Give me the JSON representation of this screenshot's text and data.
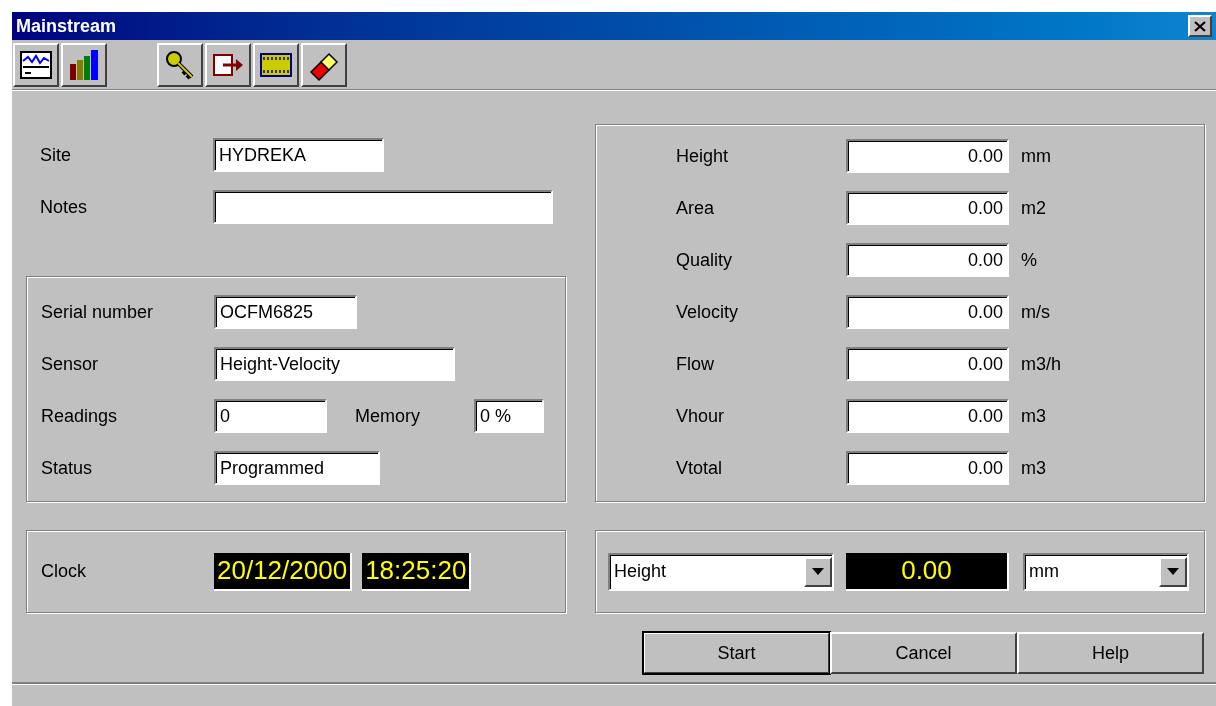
{
  "window": {
    "title": "Mainstream"
  },
  "site": {
    "label": "Site",
    "value": "HYDREKA"
  },
  "notes": {
    "label": "Notes"
  },
  "device": [
    {
      "label": "Serial number",
      "value": "OCFM6825"
    },
    {
      "label": "Sensor",
      "value": "Height-Velocity"
    },
    {
      "label": "Readings",
      "value": "0",
      "extra_label": "Memory",
      "extra_value": "0 %"
    },
    {
      "label": "Status",
      "value": "Programmed"
    }
  ],
  "measurements": [
    {
      "label": "Height",
      "value": "0.00",
      "unit": "mm"
    },
    {
      "label": "Area",
      "value": "0.00",
      "unit": "m2"
    },
    {
      "label": "Quality",
      "value": "0.00",
      "unit": "%"
    },
    {
      "label": "Velocity",
      "value": "0.00",
      "unit": "m/s"
    },
    {
      "label": "Flow",
      "value": "0.00",
      "unit": "m3/h"
    },
    {
      "label": "Vhour",
      "value": "0.00",
      "unit": "m3"
    },
    {
      "label": "Vtotal",
      "value": "0.00",
      "unit": "m3"
    }
  ],
  "clock": {
    "label": "Clock",
    "date": "20/12/2000",
    "time": "18:25:20"
  },
  "selector": {
    "quantity": "Height",
    "reading": "0.00",
    "unit": "mm"
  },
  "buttons": [
    {
      "label": "Start",
      "default": true
    },
    {
      "label": "Cancel",
      "default": false
    },
    {
      "label": "Help",
      "default": false
    }
  ]
}
